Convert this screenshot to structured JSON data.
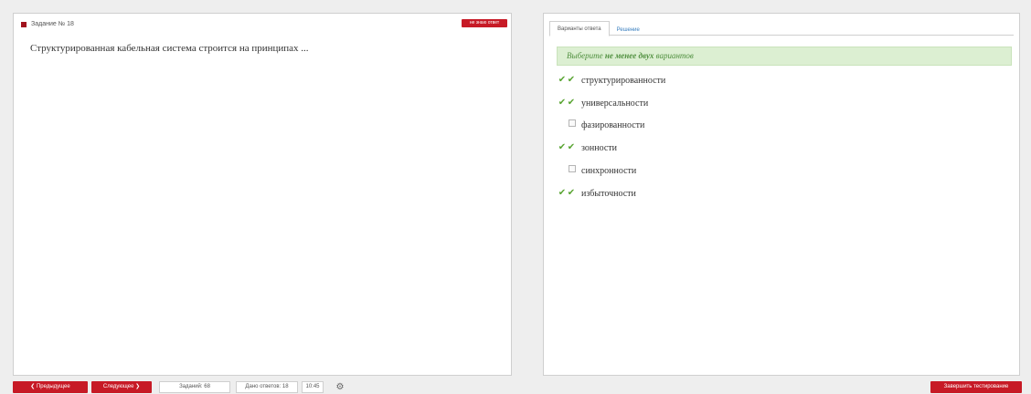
{
  "task": {
    "header": "Задание № 18",
    "unknown_button": "не знаю ответ",
    "question": "Структурированная кабельная система строится на принципах ..."
  },
  "tabs": [
    {
      "label": "Варианты ответа",
      "active": true
    },
    {
      "label": "Решение",
      "active": false
    }
  ],
  "hint": {
    "prefix": "Выберите ",
    "emphasis": "не менее двух",
    "suffix": " вариантов"
  },
  "options": [
    {
      "label": "структурированности",
      "correct": true,
      "selected": true
    },
    {
      "label": "универсальности",
      "correct": true,
      "selected": true
    },
    {
      "label": "фазированности",
      "correct": false,
      "selected": false
    },
    {
      "label": "зонности",
      "correct": true,
      "selected": true
    },
    {
      "label": "синхронности",
      "correct": false,
      "selected": false
    },
    {
      "label": "избыточности",
      "correct": true,
      "selected": true
    }
  ],
  "footer": {
    "prev_label": "❮ Предыдущее",
    "next_label": "Следующее ❯",
    "tasks_count": "Заданий: 68",
    "answers_count": "Дано ответов: 18",
    "time": "10:45",
    "finish_label": "Завершить тестирование"
  },
  "icons": {
    "gear": "gear-icon",
    "check": "check-icon",
    "flag": "flag-icon"
  },
  "colors": {
    "accent": "#c71a26",
    "hint_bg": "#dcefd2",
    "hint_text": "#4f8f3e",
    "check": "#5aa533",
    "tab_link": "#3a7fbf"
  }
}
